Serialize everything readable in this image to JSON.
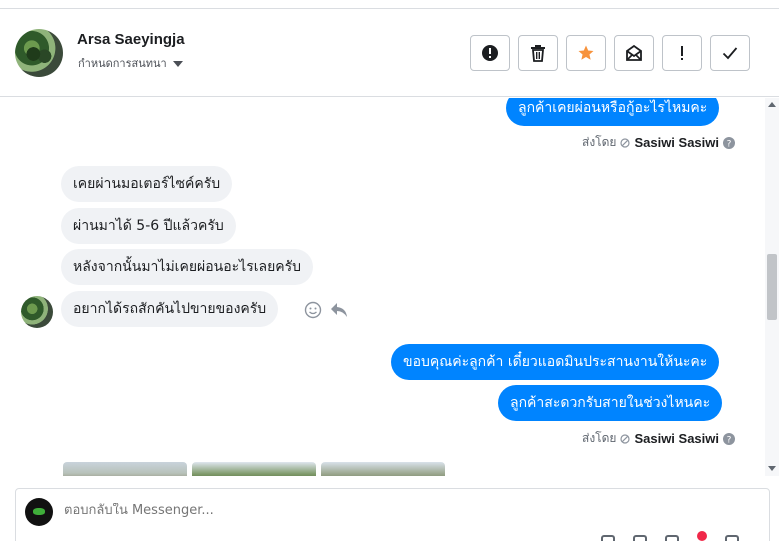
{
  "header": {
    "contact_name": "Arsa Saeyingja",
    "assign_label": "กำหนดการสนทนา",
    "actions": [
      {
        "name": "report-spam-button",
        "icon": "alert-circle-icon"
      },
      {
        "name": "delete-button",
        "icon": "trash-icon"
      },
      {
        "name": "star-button",
        "icon": "star-icon"
      },
      {
        "name": "mark-unread-button",
        "icon": "envelope-icon"
      },
      {
        "name": "follow-up-button",
        "icon": "exclamation-icon"
      },
      {
        "name": "mark-done-button",
        "icon": "check-icon"
      }
    ]
  },
  "messages": {
    "out_1": "ลูกค้าเคยผ่อนหรือกู้อะไรไหมคะ",
    "sent_by_1_prefix": "ส่งโดย",
    "sent_by_1_agent": "Sasiwi Sasiwi",
    "in_1": "เคยผ่านมอเตอร์ไซค์ครับ",
    "in_2": "ผ่านมาได้ 5-6 ปีแล้วครับ",
    "in_3": "หลังจากนั้นมาไม่เคยผ่อนอะไรเลยครับ",
    "in_4": "อยากได้รถสักคันไปขายของครับ",
    "out_2": "ขอบคุณค่ะลูกค้า เดี๋ยวแอดมินประสานงานให้นะคะ",
    "out_3": "ลูกค้าสะดวกรับสายในช่วงไหนคะ",
    "sent_by_2_prefix": "ส่งโดย",
    "sent_by_2_agent": "Sasiwi Sasiwi"
  },
  "composer": {
    "placeholder": "ตอบกลับใน Messenger..."
  },
  "colors": {
    "outgoing_bubble": "#0084ff",
    "incoming_bubble": "#f0f2f5",
    "star_accent": "#f7923b"
  }
}
